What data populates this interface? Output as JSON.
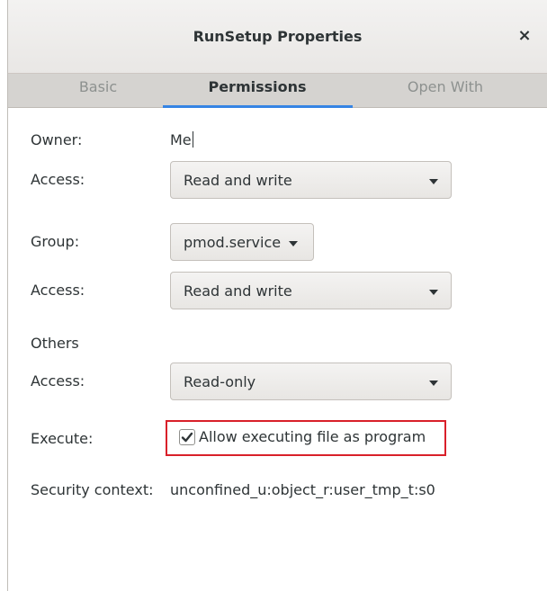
{
  "window": {
    "title": "RunSetup Properties",
    "close_glyph": "×"
  },
  "tabs": [
    {
      "label": "Basic"
    },
    {
      "label": "Permissions"
    },
    {
      "label": "Open With"
    }
  ],
  "owner": {
    "label": "Owner:",
    "value": "Me"
  },
  "owner_access": {
    "label": "Access:",
    "value": "Read and write"
  },
  "group": {
    "label": "Group:",
    "value": "pmod.service"
  },
  "group_access": {
    "label": "Access:",
    "value": "Read and write"
  },
  "others": {
    "label": "Others"
  },
  "others_access": {
    "label": "Access:",
    "value": "Read-only"
  },
  "execute": {
    "label": "Execute:",
    "checkbox_label": "Allow executing file as program",
    "checked": true
  },
  "security": {
    "label": "Security context:",
    "value": "unconfined_u:object_r:user_tmp_t:s0"
  },
  "colors": {
    "accent": "#3584e4",
    "highlight_box": "#d9202a"
  }
}
